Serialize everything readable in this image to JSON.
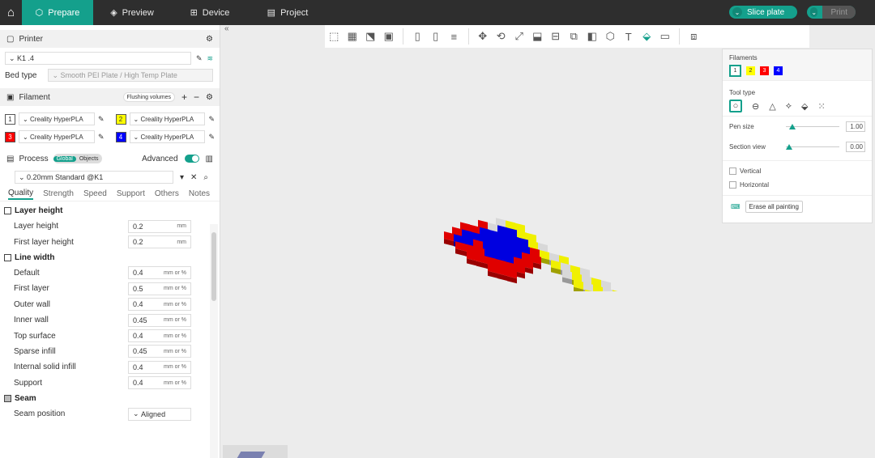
{
  "topbar": {
    "tabs": [
      {
        "label": "Prepare",
        "icon": "cube-icon"
      },
      {
        "label": "Preview",
        "icon": "layers-icon"
      },
      {
        "label": "Device",
        "icon": "device-icon"
      },
      {
        "label": "Project",
        "icon": "project-icon"
      }
    ],
    "slice_label": "Slice plate",
    "print_label": "Print"
  },
  "printer": {
    "section_label": "Printer",
    "name": "K1 .4",
    "bed_type_label": "Bed type",
    "bed_type_value": "Smooth PEI Plate / High Temp Plate"
  },
  "filament": {
    "section_label": "Filament",
    "flushing_label": "Flushing volumes",
    "slots": [
      {
        "num": "1",
        "name": "Creality HyperPLA",
        "color": "#ffffff"
      },
      {
        "num": "2",
        "name": "Creality HyperPLA",
        "color": "#ffff00"
      },
      {
        "num": "3",
        "name": "Creality HyperPLA",
        "color": "#ff0000"
      },
      {
        "num": "4",
        "name": "Creality HyperPLA",
        "color": "#0000ff"
      }
    ]
  },
  "process": {
    "section_label": "Process",
    "global_label": "Global",
    "objects_label": "Objects",
    "advanced_label": "Advanced",
    "preset": "0.20mm Standard @K1",
    "tabs": [
      "Quality",
      "Strength",
      "Speed",
      "Support",
      "Others",
      "Notes"
    ],
    "groups": [
      {
        "title": "Layer height",
        "rows": [
          {
            "label": "Layer height",
            "value": "0.2",
            "unit": "mm"
          },
          {
            "label": "First layer height",
            "value": "0.2",
            "unit": "mm"
          }
        ]
      },
      {
        "title": "Line width",
        "rows": [
          {
            "label": "Default",
            "value": "0.4",
            "unit": "mm or %"
          },
          {
            "label": "First layer",
            "value": "0.5",
            "unit": "mm or %"
          },
          {
            "label": "Outer wall",
            "value": "0.4",
            "unit": "mm or %"
          },
          {
            "label": "Inner wall",
            "value": "0.45",
            "unit": "mm or %"
          },
          {
            "label": "Top surface",
            "value": "0.4",
            "unit": "mm or %"
          },
          {
            "label": "Sparse infill",
            "value": "0.45",
            "unit": "mm or %"
          },
          {
            "label": "Internal solid infill",
            "value": "0.4",
            "unit": "mm or %"
          },
          {
            "label": "Support",
            "value": "0.4",
            "unit": "mm or %"
          }
        ]
      },
      {
        "title": "Seam",
        "rows": [
          {
            "label": "Seam position",
            "value": "Aligned",
            "unit": ""
          }
        ]
      }
    ]
  },
  "paint_panel": {
    "filaments_label": "Filaments",
    "filaments": [
      {
        "num": "1",
        "color": "#ffffff"
      },
      {
        "num": "2",
        "color": "#ffff00"
      },
      {
        "num": "3",
        "color": "#ff0000"
      },
      {
        "num": "4",
        "color": "#0000ff"
      }
    ],
    "tool_type_label": "Tool type",
    "pen_size_label": "Pen size",
    "pen_size_value": "1.00",
    "pen_size_level": 0.12,
    "section_view_label": "Section view",
    "section_view_value": "0.00",
    "section_view_level": 0.0,
    "vertical_label": "Vertical",
    "horizontal_label": "Horizontal",
    "erase_label": "Erase all painting"
  }
}
